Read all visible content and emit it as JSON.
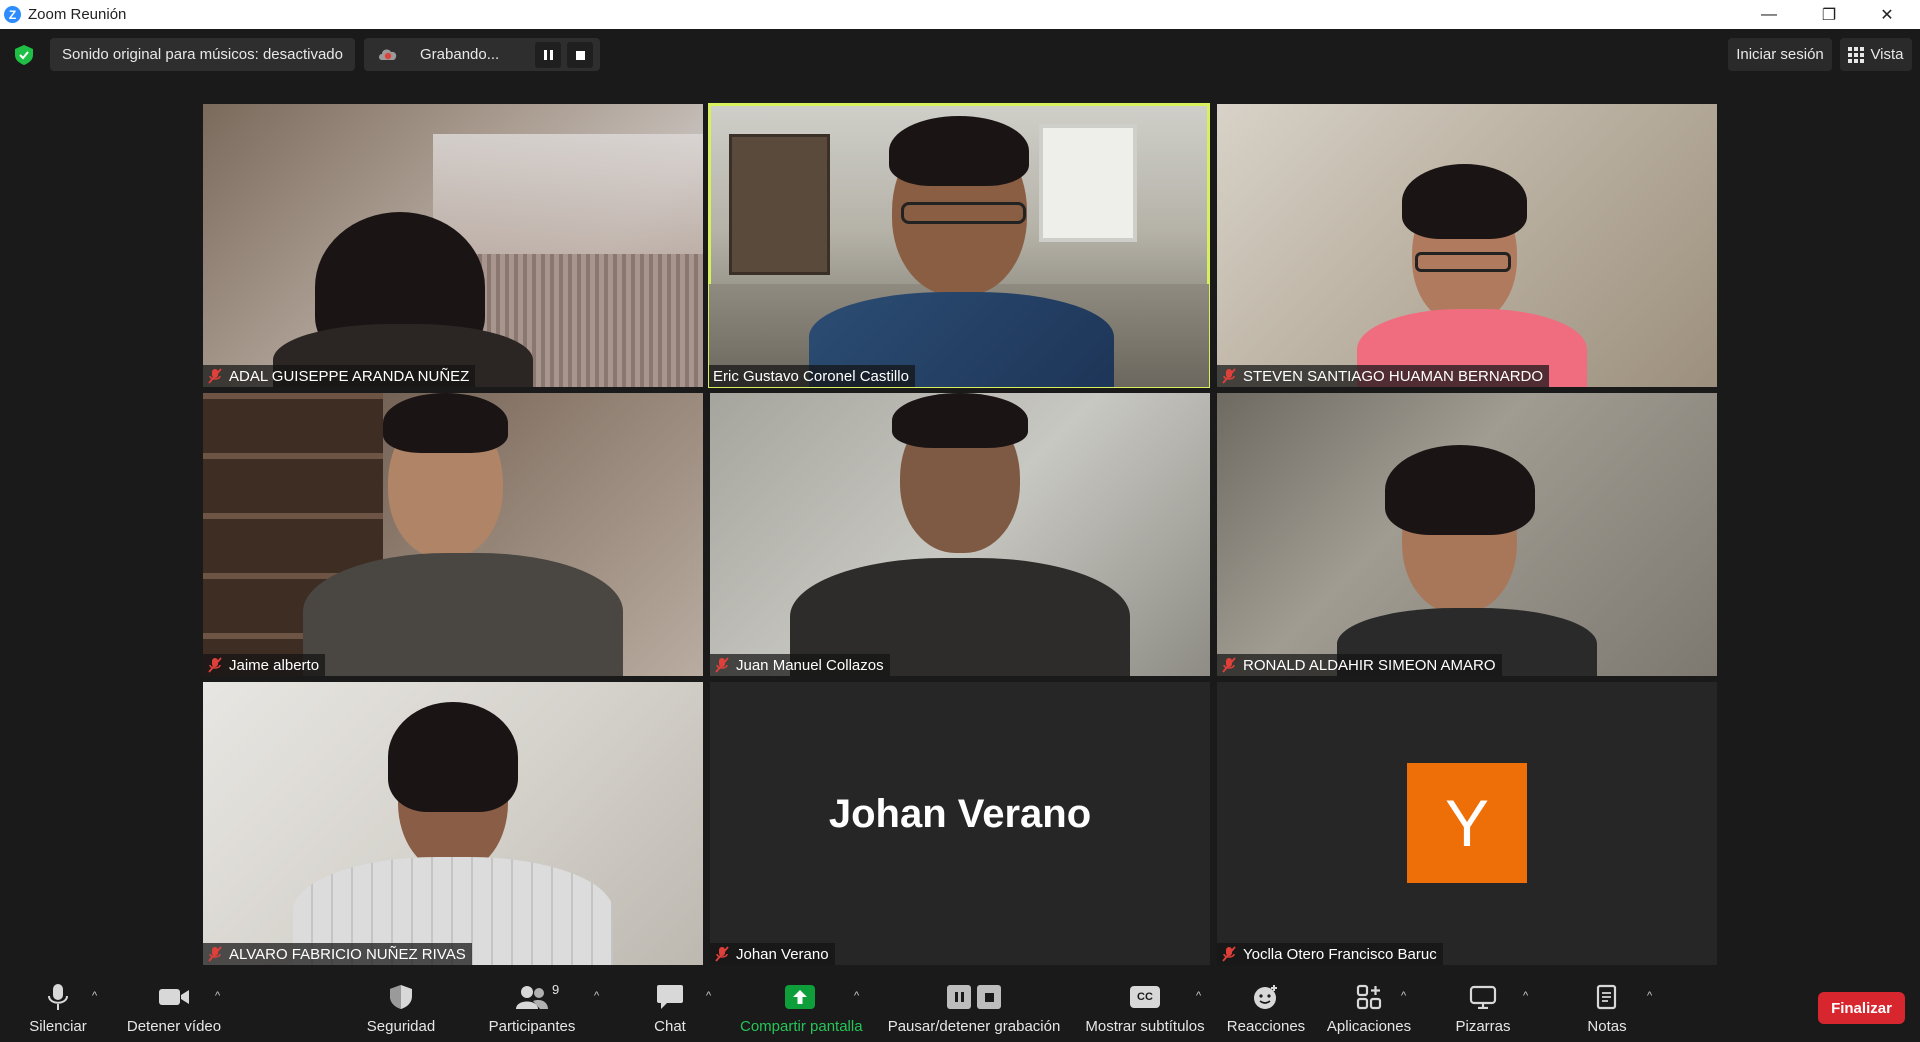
{
  "window": {
    "title": "Zoom Reunión",
    "minimize": "—",
    "restore": "❐",
    "close": "✕"
  },
  "topbar": {
    "musician_audio_label": "Sonido original para músicos: desactivado",
    "recording_label": "Grabando...",
    "sign_in_label": "Iniciar sesión",
    "view_label": "Vista"
  },
  "participants": [
    {
      "name": "ADAL GUISEPPE ARANDA NUÑEZ",
      "muted": true,
      "video": true
    },
    {
      "name": "Eric Gustavo Coronel Castillo",
      "muted": false,
      "video": true,
      "active_speaker": true
    },
    {
      "name": "STEVEN SANTIAGO HUAMAN BERNARDO",
      "muted": true,
      "video": true
    },
    {
      "name": "Jaime alberto",
      "muted": true,
      "video": true
    },
    {
      "name": "Juan Manuel Collazos",
      "muted": true,
      "video": true
    },
    {
      "name": "RONALD ALDAHIR SIMEON AMARO",
      "muted": true,
      "video": true
    },
    {
      "name": "ALVARO FABRICIO NUÑEZ RIVAS",
      "muted": true,
      "video": true
    },
    {
      "name": "Johan Verano",
      "muted": true,
      "video": false,
      "display_name": "Johan Verano"
    },
    {
      "name": "Yoclla Otero Francisco Baruc",
      "muted": true,
      "video": false,
      "avatar_letter": "Y",
      "avatar_color": "#ee6f08"
    }
  ],
  "toolbar": {
    "mute": "Silenciar",
    "stop_video": "Detener vídeo",
    "security": "Seguridad",
    "participants": "Participantes",
    "participants_count": "9",
    "chat": "Chat",
    "share_screen": "Compartir pantalla",
    "pause_stop_recording": "Pausar/detener grabación",
    "show_captions": "Mostrar subtítulos",
    "captions_icon_text": "CC",
    "reactions": "Reacciones",
    "apps": "Aplicaciones",
    "whiteboards": "Pizarras",
    "notes": "Notas",
    "end": "Finalizar",
    "caret": "^"
  },
  "colors": {
    "share_green": "#0e9f3a",
    "speaker_outline": "#d9f05e",
    "end_red": "#d8262e",
    "mute_red": "#e0403a"
  }
}
